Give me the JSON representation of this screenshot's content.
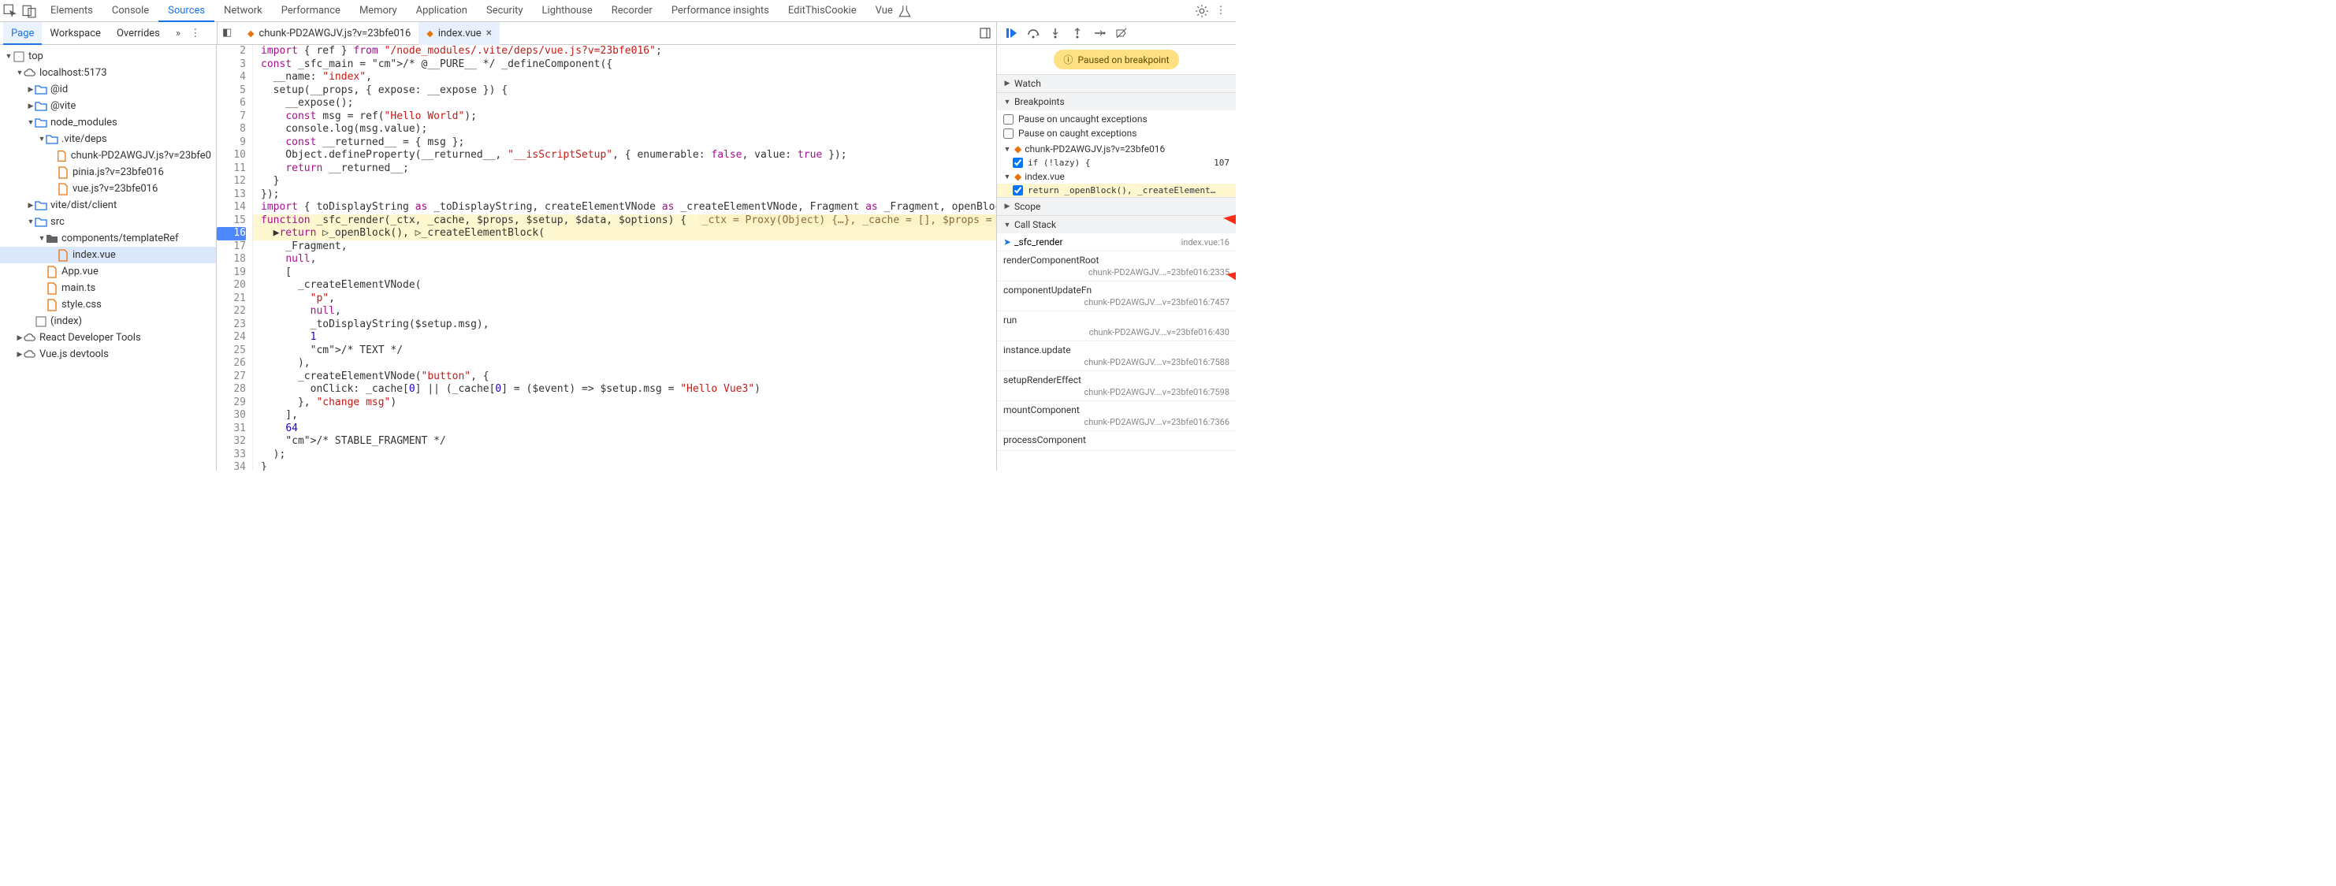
{
  "topTabs": [
    "Elements",
    "Console",
    "Sources",
    "Network",
    "Performance",
    "Memory",
    "Application",
    "Security",
    "Lighthouse",
    "Recorder",
    "Performance insights",
    "EditThisCookie",
    "Vue"
  ],
  "topActive": "Sources",
  "subTabs": [
    "Page",
    "Workspace",
    "Overrides"
  ],
  "subActive": "Page",
  "fileTabs": [
    {
      "name": "chunk-PD2AWGJV.js?v=23bfe016",
      "active": false
    },
    {
      "name": "index.vue",
      "active": true
    }
  ],
  "tree": [
    {
      "depth": 0,
      "tw": "▼",
      "icon": "page",
      "label": "top"
    },
    {
      "depth": 1,
      "tw": "▼",
      "icon": "cloud",
      "label": "localhost:5173"
    },
    {
      "depth": 2,
      "tw": "▶",
      "icon": "folder-o",
      "label": "@id"
    },
    {
      "depth": 2,
      "tw": "▶",
      "icon": "folder-o",
      "label": "@vite"
    },
    {
      "depth": 2,
      "tw": "▼",
      "icon": "folder-o",
      "label": "node_modules"
    },
    {
      "depth": 3,
      "tw": "▼",
      "icon": "folder-o",
      "label": ".vite/deps"
    },
    {
      "depth": 4,
      "tw": "",
      "icon": "file",
      "label": "chunk-PD2AWGJV.js?v=23bfe0"
    },
    {
      "depth": 4,
      "tw": "",
      "icon": "file",
      "label": "pinia.js?v=23bfe016"
    },
    {
      "depth": 4,
      "tw": "",
      "icon": "file",
      "label": "vue.js?v=23bfe016"
    },
    {
      "depth": 2,
      "tw": "▶",
      "icon": "folder-o",
      "label": "vite/dist/client"
    },
    {
      "depth": 2,
      "tw": "▼",
      "icon": "folder-o",
      "label": "src"
    },
    {
      "depth": 3,
      "tw": "▼",
      "icon": "folder",
      "label": "components/templateRef"
    },
    {
      "depth": 4,
      "tw": "",
      "icon": "file",
      "label": "index.vue",
      "sel": true
    },
    {
      "depth": 3,
      "tw": "",
      "icon": "file",
      "label": "App.vue"
    },
    {
      "depth": 3,
      "tw": "",
      "icon": "file",
      "label": "main.ts"
    },
    {
      "depth": 3,
      "tw": "",
      "icon": "file",
      "label": "style.css"
    },
    {
      "depth": 2,
      "tw": "",
      "icon": "page",
      "label": "(index)"
    },
    {
      "depth": 1,
      "tw": "▶",
      "icon": "cloud",
      "label": "React Developer Tools"
    },
    {
      "depth": 1,
      "tw": "▶",
      "icon": "cloud",
      "label": "Vue.js devtools"
    }
  ],
  "code": {
    "start": 2,
    "bpLine": 16,
    "hlLines": [
      15,
      16
    ],
    "lines": [
      "import { ref } from \"/node_modules/.vite/deps/vue.js?v=23bfe016\";",
      "const _sfc_main = /* @__PURE__ */ _defineComponent({",
      "  __name: \"index\",",
      "  setup(__props, { expose: __expose }) {",
      "    __expose();",
      "    const msg = ref(\"Hello World\");",
      "    console.log(msg.value);",
      "    const __returned__ = { msg };",
      "    Object.defineProperty(__returned__, \"__isScriptSetup\", { enumerable: false, value: true });",
      "    return __returned__;",
      "  }",
      "});",
      "import { toDisplayString as _toDisplayString, createElementVNode as _createElementVNode, Fragment as _Fragment, openBlock as _openBl",
      "function _sfc_render(_ctx, _cache, $props, $setup, $data, $options) {  _ctx = Proxy(Object) {…}, _cache = [], $props = Proxy(Object)",
      "  ▶return ▷_openBlock(), ▷_createElementBlock(",
      "    _Fragment,",
      "    null,",
      "    [",
      "      _createElementVNode(",
      "        \"p\",",
      "        null,",
      "        _toDisplayString($setup.msg),",
      "        1",
      "        /* TEXT */",
      "      ),",
      "      _createElementVNode(\"button\", {",
      "        onClick: _cache[0] || (_cache[0] = ($event) => $setup.msg = \"Hello Vue3\")",
      "      }, \"change msg\")",
      "    ],",
      "    64",
      "    /* STABLE_FRAGMENT */",
      "  );",
      "}"
    ]
  },
  "pausedBadge": "Paused on breakpoint",
  "sections": {
    "watch": "Watch",
    "breakpoints": "Breakpoints",
    "scope": "Scope",
    "callstack": "Call Stack"
  },
  "bpOptions": [
    {
      "checked": false,
      "label": "Pause on uncaught exceptions"
    },
    {
      "checked": false,
      "label": "Pause on caught exceptions"
    }
  ],
  "bpGroups": [
    {
      "file": "chunk-PD2AWGJV.js?v=23bfe016",
      "open": true,
      "items": [
        {
          "checked": true,
          "text": "if (!lazy) {",
          "line": "107"
        }
      ]
    },
    {
      "file": "index.vue",
      "open": true,
      "hl": true,
      "items": [
        {
          "checked": true,
          "text": "return _openBlock(), _createElement…",
          "hl": true
        }
      ]
    }
  ],
  "callStack": [
    {
      "name": "_sfc_render",
      "loc": "index.vue:16",
      "current": true
    },
    {
      "name": "renderComponentRoot",
      "loc": "chunk-PD2AWGJV.…=23bfe016:2335"
    },
    {
      "name": "componentUpdateFn",
      "loc": "chunk-PD2AWGJV.…v=23bfe016:7457"
    },
    {
      "name": "run",
      "loc": "chunk-PD2AWGJV.…v=23bfe016:430"
    },
    {
      "name": "instance.update",
      "loc": "chunk-PD2AWGJV.…v=23bfe016:7588"
    },
    {
      "name": "setupRenderEffect",
      "loc": "chunk-PD2AWGJV.…v=23bfe016:7598"
    },
    {
      "name": "mountComponent",
      "loc": "chunk-PD2AWGJV.…v=23bfe016:7366"
    },
    {
      "name": "processComponent",
      "loc": ""
    }
  ]
}
